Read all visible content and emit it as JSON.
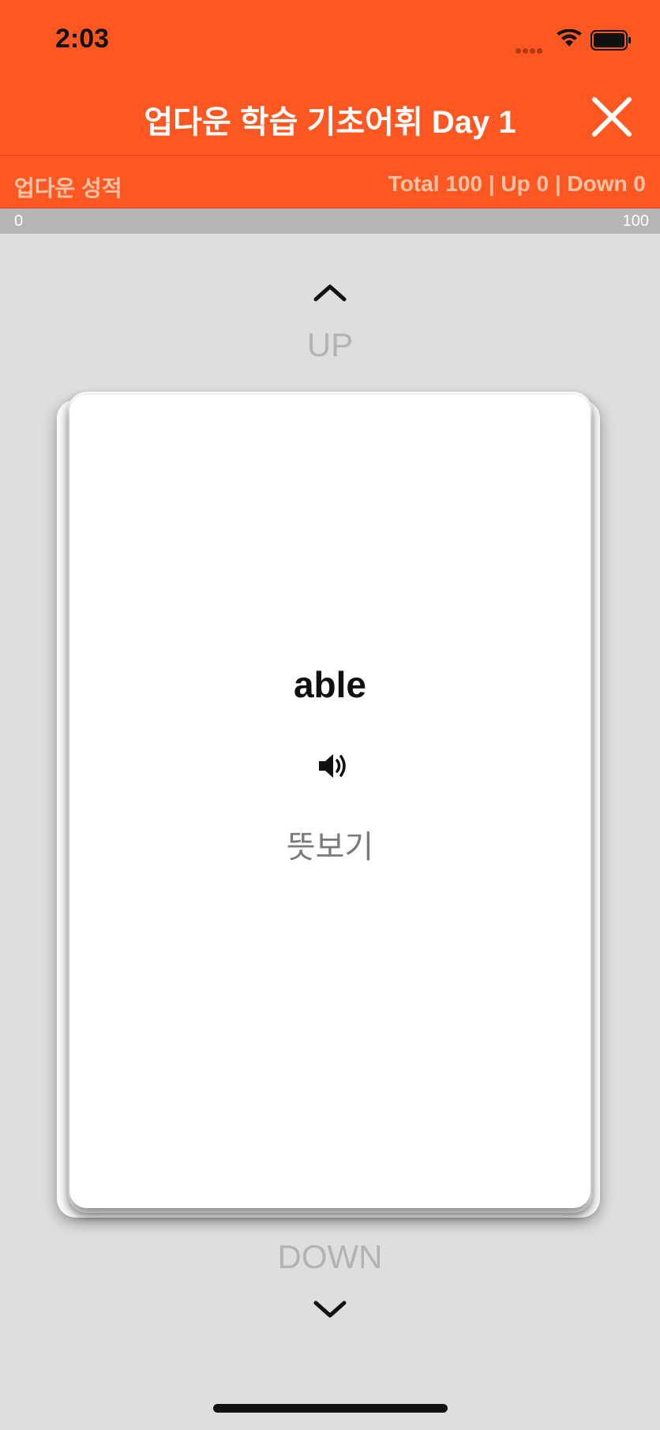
{
  "status_bar": {
    "time": "2:03"
  },
  "header": {
    "title": "업다운 학습 기초어휘 Day 1",
    "close_icon": "close-icon"
  },
  "score": {
    "label": "업다운 성적",
    "summary": "Total 100 | Up 0 | Down 0"
  },
  "progress": {
    "min": "0",
    "max": "100",
    "value": 0
  },
  "swipe": {
    "up_label": "UP",
    "down_label": "DOWN"
  },
  "card": {
    "word": "able",
    "meaning_button": "뜻보기",
    "speaker_icon": "speaker-icon"
  },
  "colors": {
    "accent": "#ff5722",
    "background": "#dedede",
    "muted_text": "#b3b3b3"
  }
}
